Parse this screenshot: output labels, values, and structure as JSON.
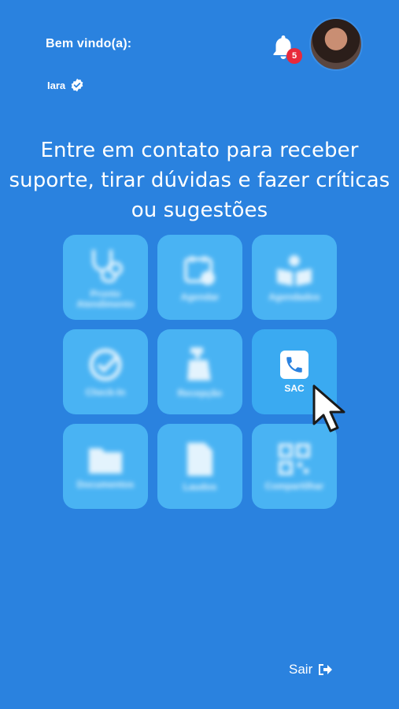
{
  "header": {
    "welcome": "Bem vindo(a):",
    "username": "Iara",
    "notifications_count": "5"
  },
  "headline": "Entre em contato para receber suporte, tirar dúvidas e fazer críticas ou sugestões",
  "menu": {
    "items": [
      {
        "label": "Pronto Atendimento",
        "icon": "stethoscope-icon"
      },
      {
        "label": "Agendar",
        "icon": "calendar-icon"
      },
      {
        "label": "Agendados",
        "icon": "book-person-icon"
      },
      {
        "label": "Check-In",
        "icon": "check-circle-icon"
      },
      {
        "label": "Recepção",
        "icon": "reception-bell-icon"
      },
      {
        "label": "SAC",
        "icon": "phone-icon"
      },
      {
        "label": "Documentos",
        "icon": "folder-icon"
      },
      {
        "label": "Laudos",
        "icon": "document-icon"
      },
      {
        "label": "Compartilhar",
        "icon": "qr-code-icon"
      }
    ]
  },
  "footer": {
    "logout_label": "Sair"
  },
  "colors": {
    "background": "#2a82df",
    "tile": "#49b3f3",
    "badge": "#e8293b"
  }
}
